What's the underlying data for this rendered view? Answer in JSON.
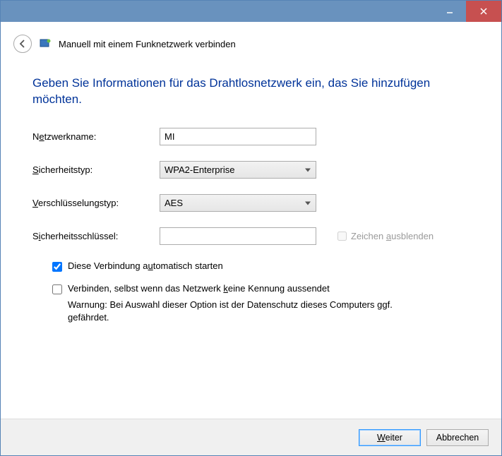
{
  "titlebar": {
    "minimize": "minimize",
    "close": "close"
  },
  "header": {
    "title": "Manuell mit einem Funknetzwerk verbinden"
  },
  "heading": "Geben Sie Informationen für das Drahtlosnetzwerk ein, das Sie hinzufügen möchten.",
  "form": {
    "network_name_label": "Netzwerkname:",
    "network_name_value": "MI",
    "security_type_label": "Sicherheitstyp:",
    "security_type_value": "WPA2-Enterprise",
    "encryption_type_label": "Verschlüsselungstyp:",
    "encryption_type_value": "AES",
    "security_key_label": "Sicherheitsschlüssel:",
    "security_key_value": "",
    "hide_chars_label": "Zeichen ausblenden",
    "auto_start_label": "Diese Verbindung automatisch starten",
    "auto_start_checked": true,
    "connect_hidden_label": "Verbinden, selbst wenn das Netzwerk keine Kennung aussendet",
    "connect_hidden_checked": false,
    "warning_text": "Warnung: Bei Auswahl dieser Option ist der Datenschutz dieses Computers ggf. gefährdet."
  },
  "footer": {
    "next_label": "Weiter",
    "cancel_label": "Abbrechen"
  }
}
